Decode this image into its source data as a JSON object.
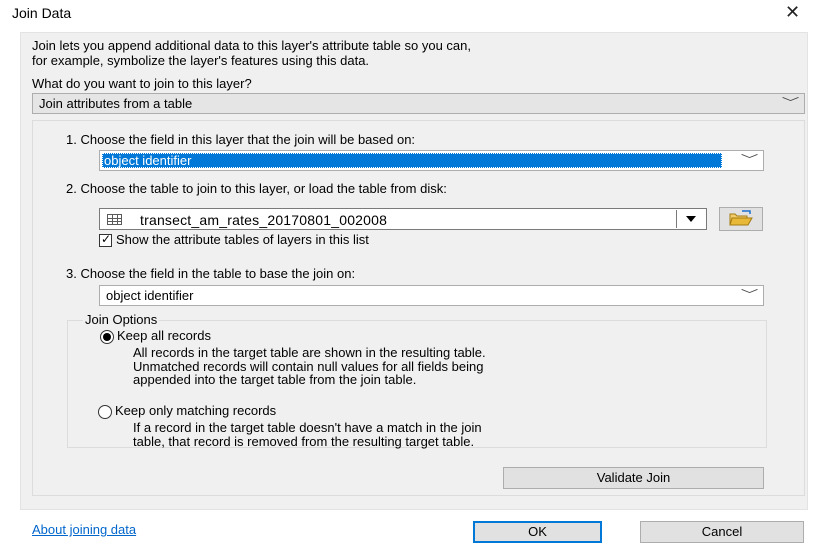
{
  "window": {
    "title": "Join Data",
    "close_glyph": "✕"
  },
  "intro": {
    "line1": "Join lets you append additional data to this layer's attribute table so you can,",
    "line2": "for example, symbolize the layer's features using this data."
  },
  "join_type": {
    "question": "What do you want to join to this layer?",
    "selected": "Join attributes from a table"
  },
  "step1": {
    "label": "1.  Choose the field in this layer that the join will be based on:",
    "selected": "object identifier"
  },
  "step2": {
    "label": "2.  Choose the table to join to this layer, or load the table from disk:",
    "selected": "transect_am_rates_20170801_002008",
    "show_layers_label": "Show the attribute tables of layers in this list",
    "show_layers_checked": true
  },
  "step3": {
    "label": "3.  Choose the field in the table to base the join on:",
    "selected": "object identifier"
  },
  "join_options": {
    "legend": "Join Options",
    "keep_all": {
      "label": "Keep all records",
      "selected": true,
      "desc": [
        "All records in the target table are shown in the resulting table.",
        "Unmatched records will contain null values for all fields being",
        "appended into the target table from the join table."
      ]
    },
    "keep_matching": {
      "label": "Keep only matching records",
      "selected": false,
      "desc": [
        "If a record in the target table doesn't have a match in the join",
        "table, that record is removed from the resulting target table."
      ]
    }
  },
  "buttons": {
    "validate": "Validate Join",
    "ok": "OK",
    "cancel": "Cancel"
  },
  "link": {
    "about": "About joining data"
  },
  "colors": {
    "accent": "#0078d7",
    "link": "#0066cc",
    "folder": "#e8b838"
  }
}
